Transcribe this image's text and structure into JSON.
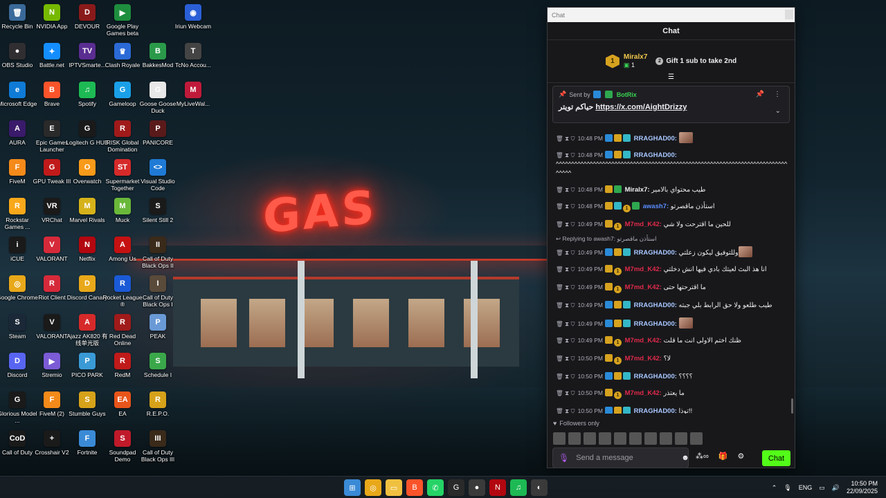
{
  "wallpaper": {
    "sign_text": "GAS"
  },
  "desktop_icons": [
    {
      "label": "Recycle Bin",
      "glyph": "🗑",
      "color": "#3a6a9a"
    },
    {
      "label": "NVIDIA App",
      "glyph": "N",
      "color": "#76b900"
    },
    {
      "label": "DEVOUR",
      "glyph": "D",
      "color": "#8a1a1a"
    },
    {
      "label": "Google Play Games beta",
      "glyph": "▶",
      "color": "#1e8e3e"
    },
    {
      "label": "Iriun Webcam",
      "glyph": "◉",
      "color": "#2a5fd6"
    },
    {
      "label": "OBS Studio",
      "glyph": "●",
      "color": "#302e31"
    },
    {
      "label": "Battle.net",
      "glyph": "✦",
      "color": "#148eff"
    },
    {
      "label": "IPTVSmarte...",
      "glyph": "TV",
      "color": "#5a2d91"
    },
    {
      "label": "Clash Royale",
      "glyph": "♛",
      "color": "#2b6ad6"
    },
    {
      "label": "BakkesMod",
      "glyph": "B",
      "color": "#2a9a4a"
    },
    {
      "label": "TcNo Accou...",
      "glyph": "T",
      "color": "#444"
    },
    {
      "label": "Microsoft Edge",
      "glyph": "e",
      "color": "#0f7bd6"
    },
    {
      "label": "Brave",
      "glyph": "B",
      "color": "#fb542b"
    },
    {
      "label": "Spotify",
      "glyph": "♫",
      "color": "#1db954"
    },
    {
      "label": "Gameloop",
      "glyph": "G",
      "color": "#1aa0e8"
    },
    {
      "label": "Goose Goose Duck",
      "glyph": "G",
      "color": "#e8e8e8"
    },
    {
      "label": "MyLiveWal...",
      "glyph": "M",
      "color": "#c01a3a"
    },
    {
      "label": "AURA",
      "glyph": "A",
      "color": "#3a1a6a"
    },
    {
      "label": "Epic Games Launcher",
      "glyph": "E",
      "color": "#2a2a2a"
    },
    {
      "label": "Logitech G HUB",
      "glyph": "G",
      "color": "#1a1a1a"
    },
    {
      "label": "RISK Global Domination",
      "glyph": "R",
      "color": "#a01a1a"
    },
    {
      "label": "PANICORE",
      "glyph": "P",
      "color": "#5a1a1a"
    },
    {
      "label": "FiveM",
      "glyph": "F",
      "color": "#f48a1a"
    },
    {
      "label": "GPU Tweak III",
      "glyph": "G",
      "color": "#c01a1a"
    },
    {
      "label": "Overwatch",
      "glyph": "O",
      "color": "#f89a1a"
    },
    {
      "label": "Supermarket Together",
      "glyph": "ST",
      "color": "#d62a2a"
    },
    {
      "label": "Visual Studio Code",
      "glyph": "<>",
      "color": "#1f7ad6"
    },
    {
      "label": "Rockstar Games ...",
      "glyph": "R",
      "color": "#f8a81a"
    },
    {
      "label": "VRChat",
      "glyph": "VR",
      "color": "#1a1a1a"
    },
    {
      "label": "Marvel Rivals",
      "glyph": "M",
      "color": "#d6b21a"
    },
    {
      "label": "Muck",
      "glyph": "M",
      "color": "#6ab83a"
    },
    {
      "label": "Silent Still 2",
      "glyph": "S",
      "color": "#1a1a1a"
    },
    {
      "label": "iCUE",
      "glyph": "i",
      "color": "#1a1a1a"
    },
    {
      "label": "VALORANT",
      "glyph": "V",
      "color": "#d62a3a"
    },
    {
      "label": "Netflix",
      "glyph": "N",
      "color": "#b20710"
    },
    {
      "label": "Among Us",
      "glyph": "A",
      "color": "#c51111"
    },
    {
      "label": "Call of Duty Black Ops II",
      "glyph": "II",
      "color": "#3a2a1a"
    },
    {
      "label": "Google Chrome",
      "glyph": "◎",
      "color": "#e8a81a"
    },
    {
      "label": "Riot Client",
      "glyph": "R",
      "color": "#d62a3a"
    },
    {
      "label": "Discord Canary",
      "glyph": "D",
      "color": "#e8a81a"
    },
    {
      "label": "Rocket League ®",
      "glyph": "R",
      "color": "#1a5ad6"
    },
    {
      "label": "Call of Duty Black Ops I",
      "glyph": "I",
      "color": "#5a4a3a"
    },
    {
      "label": "Steam",
      "glyph": "S",
      "color": "#1b2838"
    },
    {
      "label": "VALORANT",
      "glyph": "V",
      "color": "#1a1a1a"
    },
    {
      "label": "Ajazz AK820 有线单光版",
      "glyph": "A",
      "color": "#d62a2a"
    },
    {
      "label": "Red Dead Online",
      "glyph": "R",
      "color": "#a01a1a"
    },
    {
      "label": "PEAK",
      "glyph": "P",
      "color": "#6a9ad6"
    },
    {
      "label": "Discord",
      "glyph": "D",
      "color": "#5865f2"
    },
    {
      "label": "Stremio",
      "glyph": "▶",
      "color": "#7b5bd6"
    },
    {
      "label": "PICO PARK",
      "glyph": "P",
      "color": "#3a9ad6"
    },
    {
      "label": "RedM",
      "glyph": "R",
      "color": "#c01a1a"
    },
    {
      "label": "Schedule I",
      "glyph": "S",
      "color": "#3aa84a"
    },
    {
      "label": "Glorious Model ...",
      "glyph": "G",
      "color": "#1a1a1a"
    },
    {
      "label": "FiveM (2)",
      "glyph": "F",
      "color": "#f48a1a"
    },
    {
      "label": "Stumble Guys",
      "glyph": "S",
      "color": "#d6a21a"
    },
    {
      "label": "EA",
      "glyph": "EA",
      "color": "#e8551a"
    },
    {
      "label": "R.E.P.O.",
      "glyph": "R",
      "color": "#d6a21a"
    },
    {
      "label": "Call of Duty",
      "glyph": "CoD",
      "color": "#1a1a1a"
    },
    {
      "label": "Crosshair V2",
      "glyph": "+",
      "color": "#1a1a1a"
    },
    {
      "label": "Fortnite",
      "glyph": "F",
      "color": "#3a8ad6"
    },
    {
      "label": "Soundpad Demo",
      "glyph": "S",
      "color": "#c01a2a"
    },
    {
      "label": "Call of Duty Black Ops III",
      "glyph": "III",
      "color": "#3a2a1a"
    }
  ],
  "taskbar": {
    "apps": [
      {
        "name": "start-icon",
        "glyph": "⊞",
        "color": "#3a8ad6"
      },
      {
        "name": "chrome-icon",
        "glyph": "◎",
        "color": "#e8a81a"
      },
      {
        "name": "file-explorer-icon",
        "glyph": "▭",
        "color": "#f0c040"
      },
      {
        "name": "brave-icon",
        "glyph": "B",
        "color": "#fb542b"
      },
      {
        "name": "whatsapp-icon",
        "glyph": "✆",
        "color": "#25d366"
      },
      {
        "name": "logitech-icon",
        "glyph": "G",
        "color": "#2a2a2a"
      },
      {
        "name": "obs-icon",
        "glyph": "●",
        "color": "#3a3a3a"
      },
      {
        "name": "netflix-icon",
        "glyph": "N",
        "color": "#b20710"
      },
      {
        "name": "spotify-icon",
        "glyph": "♫",
        "color": "#1db954"
      },
      {
        "name": "discord-icon",
        "glyph": "◐",
        "color": "#3a3a3a"
      }
    ],
    "lang": "ENG",
    "time": "10:50 PM",
    "date": "22/09/2025"
  },
  "chat": {
    "window_title": "Chat",
    "header": "Chat",
    "leaderboard": {
      "rank": "1",
      "name": "Miralx7",
      "count": "1",
      "gift_text": "Gift 1 sub to take 2nd",
      "gift_rank": "2"
    },
    "pinned": {
      "sent_by": "Sent by",
      "bot": "BotRix",
      "text_ar": "حياكم تويتر",
      "link": "https://x.com/AightDrizzy"
    },
    "messages": [
      {
        "time": "10:48 PM",
        "user": "RRAGHAD00:",
        "color": "#a8c7ff",
        "text": "",
        "badges": [
          "blue",
          "gold",
          "cyan"
        ],
        "emote": true
      },
      {
        "time": "10:48 PM",
        "user": "RRAGHAD00:",
        "color": "#a8c7ff",
        "text": "^^^^^^^^^^^^^^^^^^^^^^^^^^^^^^^^^^^^^^^^^^^^^^^^^^^^^^^^^^^^^^^^^^^^^^^^^^^^^^^^",
        "badges": [
          "blue",
          "gold",
          "cyan"
        ]
      },
      {
        "time": "10:48 PM",
        "user": "Miralx7:",
        "color": "#efeff1",
        "text": "طيب محتواي بالامير",
        "badges": [
          "gold",
          "green"
        ]
      },
      {
        "time": "10:48 PM",
        "user": "awash7:",
        "color": "#5a8cff",
        "text": "استأذن ماقصرتو",
        "badges": [
          "gold",
          "cyan",
          "coin",
          "green"
        ]
      },
      {
        "time": "10:49 PM",
        "user": "M7md_K42:",
        "color": "#e02a4a",
        "text": "للحين ما اقترحت ولا شي",
        "badges": [
          "gold",
          "coin"
        ]
      },
      {
        "time": "10:49 PM",
        "user": "RRAGHAD00:",
        "color": "#a8c7ff",
        "text": "وللتوفيق ليكون زعلتي",
        "badges": [
          "blue",
          "gold",
          "cyan"
        ],
        "reply": "Replying to awash7: استأذن ماقصرتو",
        "emote": true
      },
      {
        "time": "10:49 PM",
        "user": "M7md_K42:",
        "color": "#e02a4a",
        "text": "انا هذ البث لعيتك بادي فيها انش دخلتي",
        "badges": [
          "gold",
          "coin"
        ]
      },
      {
        "time": "10:49 PM",
        "user": "M7md_K42:",
        "color": "#e02a4a",
        "text": "ما اقترحتها حتى",
        "badges": [
          "gold",
          "coin"
        ]
      },
      {
        "time": "10:49 PM",
        "user": "RRAGHAD00:",
        "color": "#a8c7ff",
        "text": "طيب طلعو ولا حق الرابط بلي جبته",
        "badges": [
          "blue",
          "gold",
          "cyan"
        ]
      },
      {
        "time": "10:49 PM",
        "user": "RRAGHAD00:",
        "color": "#a8c7ff",
        "text": "",
        "badges": [
          "blue",
          "gold",
          "cyan"
        ],
        "emote": true
      },
      {
        "time": "10:49 PM",
        "user": "M7md_K42:",
        "color": "#e02a4a",
        "text": "ظنك اختم الاولى انت ما قلت",
        "badges": [
          "gold",
          "coin"
        ]
      },
      {
        "time": "10:50 PM",
        "user": "M7md_K42:",
        "color": "#e02a4a",
        "text": "لا؟",
        "badges": [
          "gold",
          "coin"
        ]
      },
      {
        "time": "10:50 PM",
        "user": "RRAGHAD00:",
        "color": "#a8c7ff",
        "text": "؟؟؟؟",
        "badges": [
          "blue",
          "gold",
          "cyan"
        ]
      },
      {
        "time": "10:50 PM",
        "user": "M7md_K42:",
        "color": "#e02a4a",
        "text": "ما يعتذر",
        "badges": [
          "gold",
          "coin"
        ]
      },
      {
        "time": "10:50 PM",
        "user": "RRAGHAD00:",
        "color": "#a8c7ff",
        "text": "توذا!!",
        "badges": [
          "blue",
          "gold",
          "cyan"
        ]
      }
    ],
    "followers_only": "Followers only",
    "input_placeholder": "Send a message",
    "send_label": "Chat"
  }
}
